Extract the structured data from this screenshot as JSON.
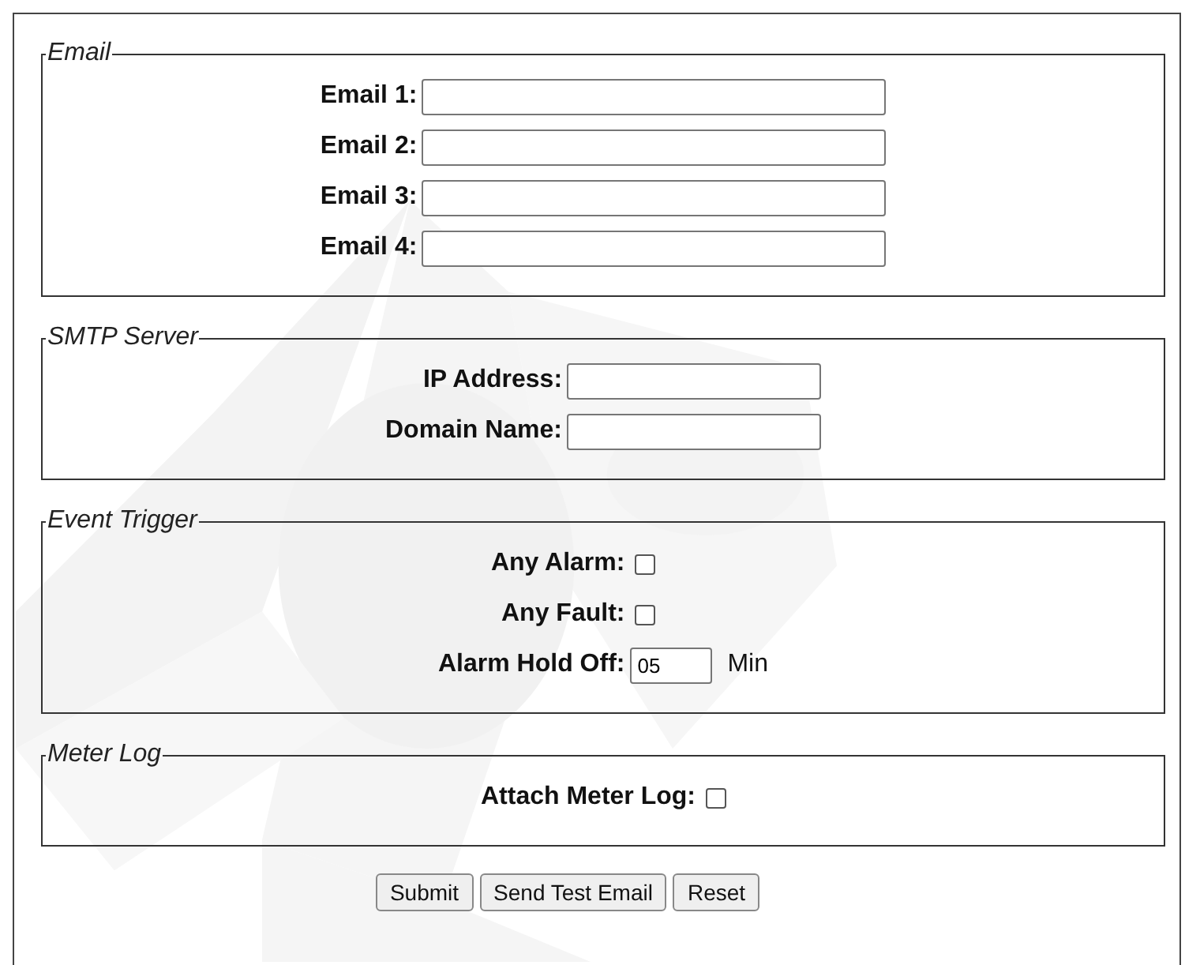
{
  "sections": [
    {
      "legend": "Email",
      "rows": [
        {
          "kind": "long-text",
          "label": "Email 1:"
        },
        {
          "kind": "long-text",
          "label": "Email 2:"
        },
        {
          "kind": "long-text",
          "label": "Email 3:"
        },
        {
          "kind": "long-text",
          "label": "Email 4:"
        }
      ]
    },
    {
      "legend": "SMTP Server",
      "rows": [
        {
          "kind": "short-text",
          "label": "IP Address:"
        },
        {
          "kind": "short-text",
          "label": "Domain Name:"
        }
      ]
    },
    {
      "legend": "Event Trigger",
      "rows": [
        {
          "kind": "checkbox",
          "label": "Any Alarm:",
          "checked": false
        },
        {
          "kind": "checkbox",
          "label": "Any Fault:",
          "checked": false
        },
        {
          "kind": "number",
          "label": "Alarm Hold Off:",
          "value": "05",
          "unit": "Min"
        }
      ]
    },
    {
      "legend": "Meter Log",
      "rows": [
        {
          "kind": "checkbox",
          "label": "Attach Meter Log:",
          "checked": false
        }
      ]
    }
  ],
  "buttons": [
    "Submit",
    "Send Test Email",
    "Reset"
  ]
}
